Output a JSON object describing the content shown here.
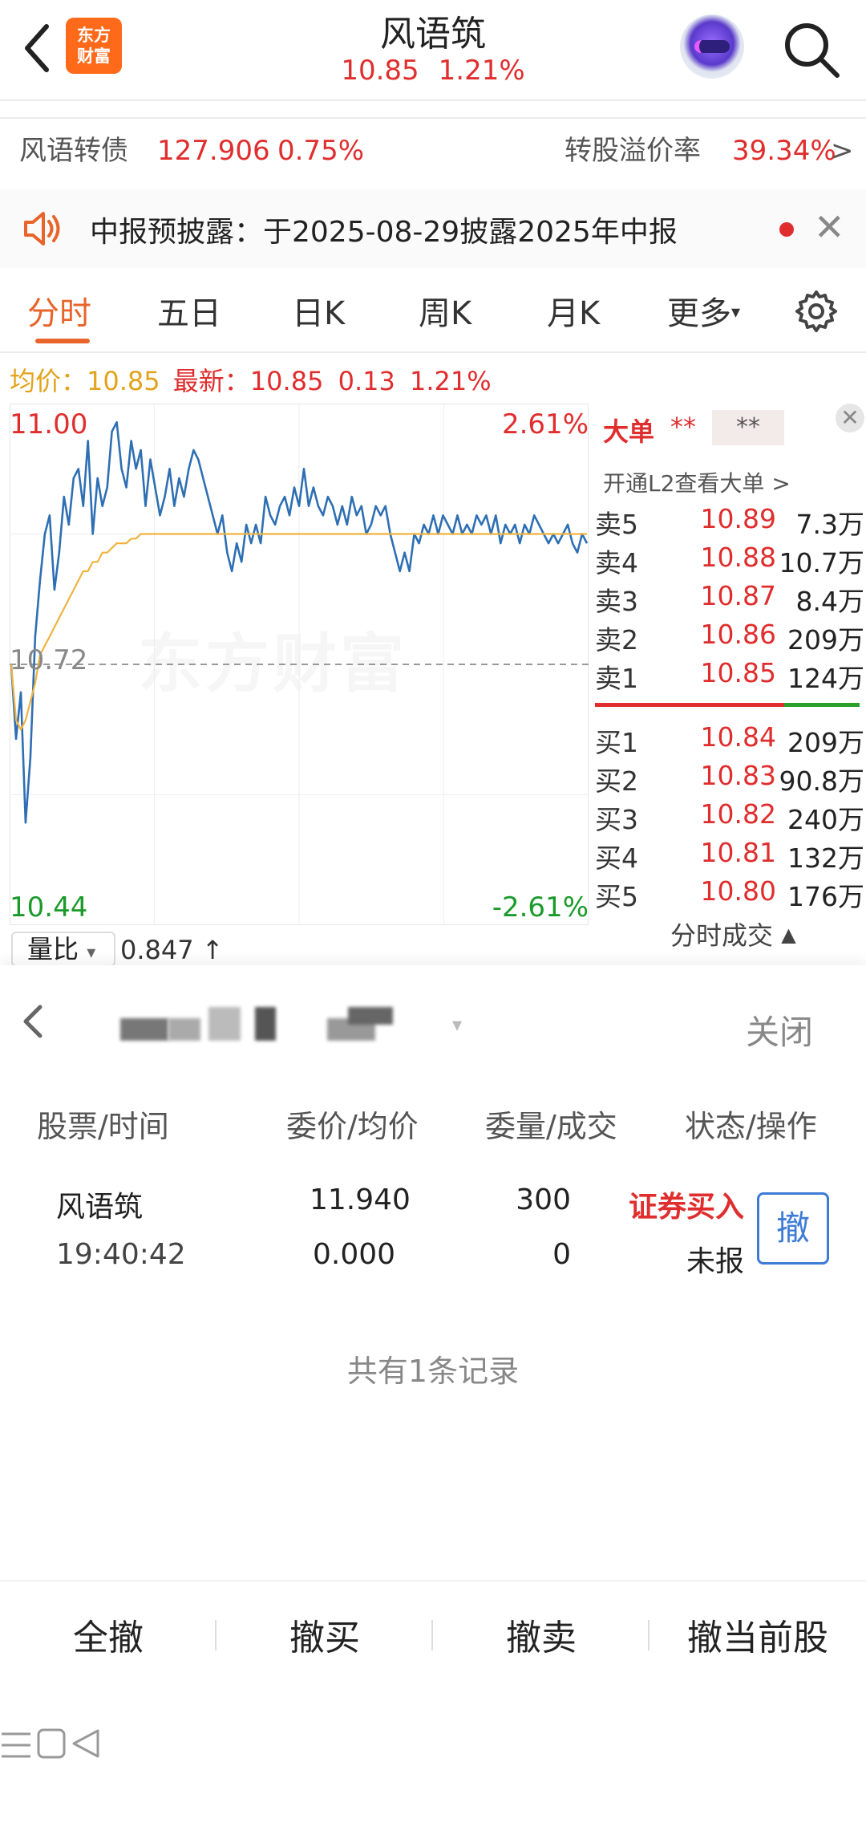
{
  "header": {
    "logo_line1": "东方",
    "logo_line2": "财富",
    "title": "风语筑",
    "price": "10.85",
    "change_pct": "1.21%"
  },
  "bond": {
    "label": "风语转债",
    "price": "127.906",
    "change_pct": "0.75%",
    "premium_label": "转股溢价率",
    "premium_value": "39.34%",
    "arrow": ">"
  },
  "notice": {
    "text": "中报预披露：于2025-08-29披露2025年中报"
  },
  "tabs": [
    "分时",
    "五日",
    "日K",
    "周K",
    "月K",
    "更多"
  ],
  "active_tab": 0,
  "stats": {
    "avg_label": "均价：",
    "avg_value": "10.85",
    "latest_label": "最新：",
    "latest_value": "10.85",
    "change": "0.13",
    "change_pct": "1.21%"
  },
  "chart_data": {
    "type": "line",
    "y_high": "11.00",
    "y_low": "10.44",
    "y_mid": "10.72",
    "pct_high": "2.61%",
    "pct_low": "-2.61%",
    "watermark": "东方财富",
    "ylim": [
      10.44,
      11.0
    ],
    "prev_close": 10.72,
    "series": [
      {
        "values": [
          10.72,
          10.64,
          10.69,
          10.55,
          10.62,
          10.75,
          10.81,
          10.86,
          10.88,
          10.8,
          10.84,
          10.9,
          10.87,
          10.92,
          10.93,
          10.89,
          10.96,
          10.86,
          10.92,
          10.89,
          10.91,
          10.97,
          10.98,
          10.93,
          10.91,
          10.96,
          10.93,
          10.95,
          10.89,
          10.94,
          10.91,
          10.88,
          10.9,
          10.93,
          10.89,
          10.92,
          10.9,
          10.93,
          10.95,
          10.94,
          10.92,
          10.9,
          10.88,
          10.86,
          10.88,
          10.84,
          10.82,
          10.85,
          10.83,
          10.87,
          10.85,
          10.87,
          10.85,
          10.9,
          10.88,
          10.87,
          10.89,
          10.9,
          10.88,
          10.91,
          10.89,
          10.93,
          10.89,
          10.91,
          10.89,
          10.88,
          10.9,
          10.89,
          10.87,
          10.89,
          10.87,
          10.9,
          10.88,
          10.89,
          10.86,
          10.87,
          10.89,
          10.88,
          10.89,
          10.86,
          10.84,
          10.82,
          10.84,
          10.82,
          10.86,
          10.85,
          10.87,
          10.86,
          10.88,
          10.86,
          10.88,
          10.87,
          10.86,
          10.88,
          10.86,
          10.87,
          10.86,
          10.88,
          10.87,
          10.88,
          10.86,
          10.88,
          10.85,
          10.87,
          10.86,
          10.87,
          10.85,
          10.87,
          10.86,
          10.88,
          10.87,
          10.86,
          10.85,
          10.86,
          10.85,
          10.86,
          10.87,
          10.85,
          10.84,
          10.86,
          10.85
        ]
      },
      {
        "values": [
          10.72,
          10.66,
          10.65,
          10.66,
          10.68,
          10.7,
          10.73,
          10.74,
          10.75,
          10.76,
          10.77,
          10.78,
          10.79,
          10.8,
          10.81,
          10.82,
          10.82,
          10.83,
          10.83,
          10.84,
          10.84,
          10.845,
          10.85,
          10.85,
          10.85,
          10.855,
          10.855,
          10.86,
          10.86,
          10.86,
          10.86,
          10.86,
          10.86,
          10.86,
          10.86,
          10.86,
          10.86,
          10.86,
          10.86,
          10.86,
          10.86,
          10.86,
          10.86,
          10.86,
          10.86,
          10.86,
          10.86,
          10.86,
          10.86,
          10.86,
          10.86,
          10.86,
          10.86,
          10.86,
          10.86,
          10.86,
          10.86,
          10.86,
          10.86,
          10.86,
          10.86,
          10.86,
          10.86,
          10.86,
          10.86,
          10.86,
          10.86,
          10.86,
          10.86,
          10.86,
          10.86,
          10.86,
          10.86,
          10.86,
          10.86,
          10.86,
          10.86,
          10.86,
          10.86,
          10.86,
          10.86,
          10.86,
          10.86,
          10.86,
          10.86,
          10.86,
          10.86,
          10.86,
          10.86,
          10.86,
          10.86,
          10.86,
          10.86,
          10.86,
          10.86,
          10.86,
          10.86,
          10.86,
          10.86,
          10.86,
          10.86,
          10.86,
          10.86,
          10.86,
          10.86,
          10.86,
          10.86,
          10.86,
          10.86,
          10.86,
          10.86,
          10.86,
          10.86,
          10.86,
          10.86,
          10.86,
          10.86,
          10.86,
          10.86,
          10.86,
          10.86
        ]
      }
    ]
  },
  "orderbook": {
    "title": "大单",
    "stars1": "**",
    "stars2": "**",
    "l2_text": "开通L2查看大单 >",
    "asks": [
      {
        "name": "卖5",
        "price": "10.89",
        "qty": "7.3万"
      },
      {
        "name": "卖4",
        "price": "10.88",
        "qty": "10.7万"
      },
      {
        "name": "卖3",
        "price": "10.87",
        "qty": "8.4万"
      },
      {
        "name": "卖2",
        "price": "10.86",
        "qty": "209万"
      },
      {
        "name": "卖1",
        "price": "10.85",
        "qty": "124万"
      }
    ],
    "bids": [
      {
        "name": "买1",
        "price": "10.84",
        "qty": "209万"
      },
      {
        "name": "买2",
        "price": "10.83",
        "qty": "90.8万"
      },
      {
        "name": "买3",
        "price": "10.82",
        "qty": "240万"
      },
      {
        "name": "买4",
        "price": "10.81",
        "qty": "132万"
      },
      {
        "name": "买5",
        "price": "10.80",
        "qty": "176万"
      }
    ],
    "footer": "分时成交"
  },
  "volume_ratio": {
    "label": "量比",
    "value": "0.847"
  },
  "panel": {
    "close_label": "关闭",
    "headers": [
      "股票/时间",
      "委价/均价",
      "委量/成交",
      "状态/操作"
    ],
    "order": {
      "name": "风语筑",
      "time": "19:40:42",
      "price": "11.940",
      "avg": "0.000",
      "qty": "300",
      "filled": "0",
      "type": "证券买入",
      "status": "未报",
      "cancel": "撤"
    },
    "count": "共有1条记录",
    "actions": [
      "全撤",
      "撤买",
      "撤卖",
      "撤当前股"
    ]
  },
  "colors": {
    "up": "#e02d2d",
    "down": "#1a9a2a",
    "accent": "#e8642a",
    "price_line": "#2e6fb3",
    "avg_line": "#f0b340"
  }
}
